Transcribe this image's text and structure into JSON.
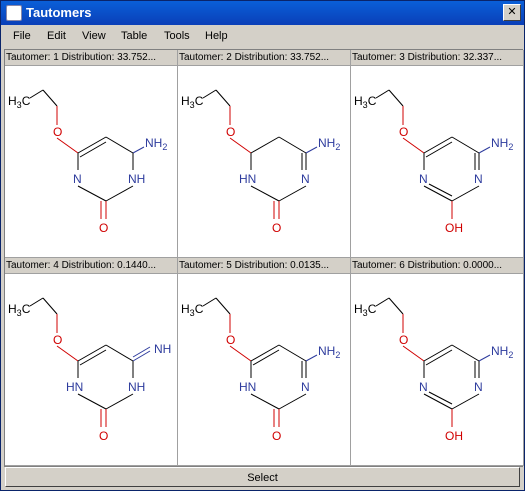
{
  "window": {
    "title": "Tautomers",
    "close_label": "✕"
  },
  "menu": [
    {
      "label": "File"
    },
    {
      "label": "Edit"
    },
    {
      "label": "View"
    },
    {
      "label": "Table"
    },
    {
      "label": "Tools"
    },
    {
      "label": "Help"
    }
  ],
  "tautomers": [
    {
      "label": "Tautomer: 1  Distribution: 33.752..."
    },
    {
      "label": "Tautomer: 2  Distribution: 33.752..."
    },
    {
      "label": "Tautomer: 3  Distribution: 32.337..."
    },
    {
      "label": "Tautomer: 4  Distribution: 0.1440..."
    },
    {
      "label": "Tautomer: 5  Distribution: 0.0135..."
    },
    {
      "label": "Tautomer: 6  Distribution: 0.0000..."
    }
  ],
  "button": {
    "select_label": "Select"
  },
  "structure_labels": {
    "methyl": "H3C",
    "oxygen": "O",
    "amine": "NH2",
    "imine": "NH",
    "ring_nh": "NH",
    "hn": "HN",
    "ring_n": "N",
    "hydroxyl": "OH"
  },
  "colors": {
    "oxygen": "#d00000",
    "nitrogen": "#2d3b9d",
    "carbon": "#000000"
  }
}
